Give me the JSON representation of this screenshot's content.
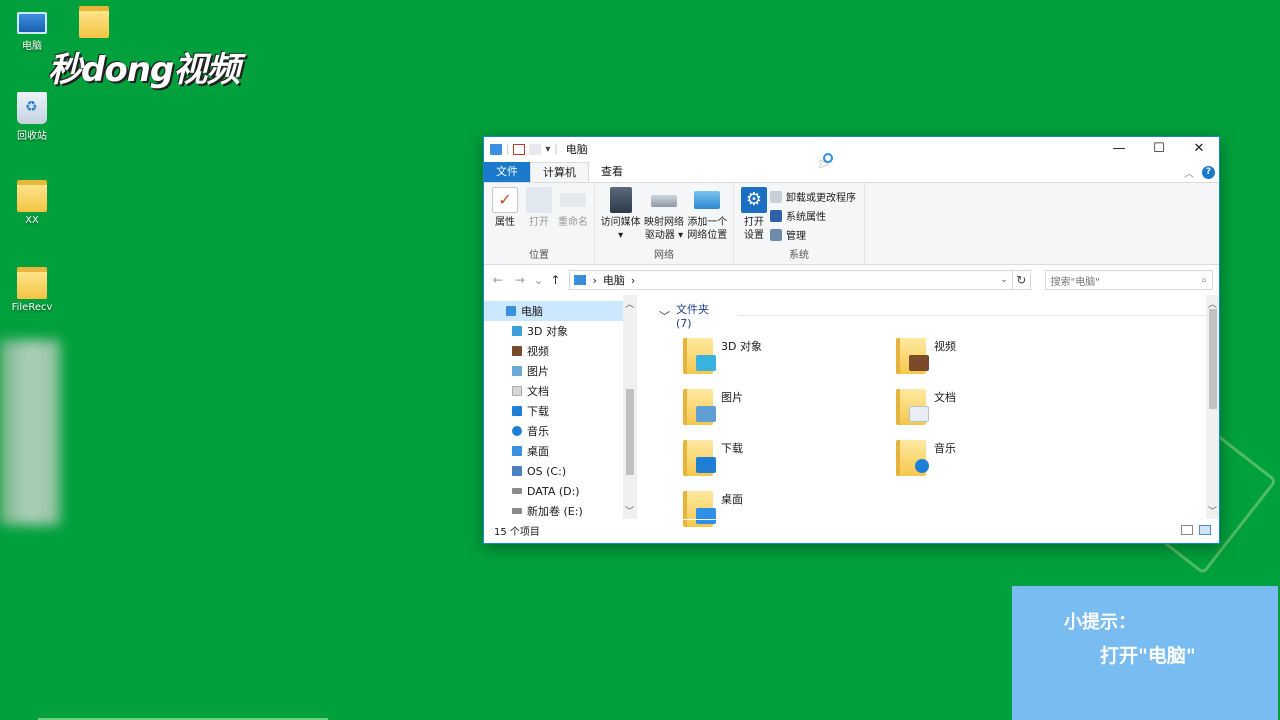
{
  "desktop": {
    "icons": [
      {
        "label": "电脑",
        "icon": "computer-icon"
      },
      {
        "label": "",
        "icon": "folder-icon"
      },
      {
        "label": "回收站",
        "icon": "recycle-bin-icon"
      },
      {
        "label": "XX",
        "icon": "folder-icon"
      },
      {
        "label": "FileRecv",
        "icon": "folder-icon"
      }
    ],
    "watermark": "秒dong视频",
    "background": "#00a03c"
  },
  "window": {
    "title": "电脑",
    "quick_access_arrow": "▾",
    "controls": {
      "minimize": "—",
      "maximize": "☐",
      "close": "✕"
    },
    "tabs": [
      {
        "label": "文件",
        "state": "file"
      },
      {
        "label": "计算机",
        "state": "active"
      },
      {
        "label": "查看",
        "state": "normal"
      }
    ],
    "help": "?",
    "collapse": "︿",
    "ribbon": {
      "location": {
        "label": "位置",
        "buttons": [
          {
            "label": "属性",
            "icon": "properties-icon",
            "enabled": true
          },
          {
            "label": "打开",
            "icon": "open-icon",
            "enabled": false
          },
          {
            "label": "重命名",
            "icon": "rename-icon",
            "enabled": false
          }
        ]
      },
      "network": {
        "label": "网络",
        "buttons": [
          {
            "label": "访问媒体",
            "label2": "▾",
            "icon": "media-icon"
          },
          {
            "label": "映射网络",
            "label2": "驱动器 ▾",
            "icon": "map-drive-icon"
          },
          {
            "label": "添加一个",
            "label2": "网络位置",
            "icon": "network-location-icon"
          }
        ]
      },
      "system": {
        "label": "系统",
        "big": {
          "label": "打开",
          "label2": "设置",
          "icon": "settings-gear-icon"
        },
        "small": [
          {
            "label": "卸载或更改程序",
            "icon": "uninstall-icon"
          },
          {
            "label": "系统属性",
            "icon": "system-properties-icon"
          },
          {
            "label": "管理",
            "icon": "manage-icon"
          }
        ]
      }
    },
    "address": {
      "back": "←",
      "forward": "→",
      "recent": "⌄",
      "up": "↑",
      "path": "电脑",
      "sep": "›",
      "dropdown": "⌄",
      "refresh": "↻",
      "search_placeholder": "搜索\"电脑\"",
      "search_icon": "⌕"
    },
    "nav_pane": {
      "root": "电脑",
      "items": [
        {
          "label": "3D 对象",
          "color": "#3aa0d8"
        },
        {
          "label": "视频",
          "color": "#7b4a2a"
        },
        {
          "label": "图片",
          "color": "#69a8d8"
        },
        {
          "label": "文档",
          "color": "#d7d7d7"
        },
        {
          "label": "下载",
          "color": "#1f7fd6"
        },
        {
          "label": "音乐",
          "color": "#1f7fd6"
        },
        {
          "label": "桌面",
          "color": "#3a8fe0"
        },
        {
          "label": "OS (C:)",
          "color": "#4a7fc0"
        },
        {
          "label": "DATA (D:)",
          "color": "#8a8a8a"
        },
        {
          "label": "新加卷 (E:)",
          "color": "#8a8a8a"
        }
      ],
      "scroll_up": "︿",
      "scroll_down": "﹀"
    },
    "content": {
      "section_title": "文件夹 (7)",
      "section_toggle": "﹀",
      "folders": [
        {
          "label": "3D 对象",
          "overlay": "#39b2e0"
        },
        {
          "label": "视频",
          "overlay": "#7b4a2a"
        },
        {
          "label": "图片",
          "overlay": "#5f9fd3"
        },
        {
          "label": "文档",
          "overlay": "#e9eef3"
        },
        {
          "label": "下载",
          "overlay": "#1f7fd6"
        },
        {
          "label": "音乐",
          "overlay": "#1f7fd6"
        },
        {
          "label": "桌面",
          "overlay": "#2d8fe6"
        }
      ]
    },
    "status": "15 个项目",
    "accent": "#1979ca"
  },
  "tip": {
    "title": "小提示：",
    "text": "打开\"电脑\"",
    "background": "#79bcf2"
  }
}
